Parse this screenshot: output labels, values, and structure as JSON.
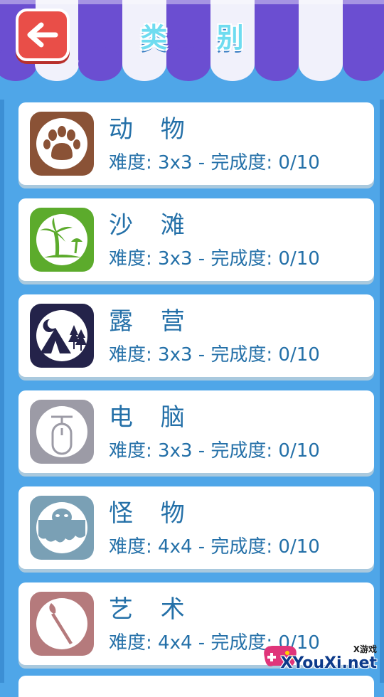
{
  "header": {
    "title": "类 别",
    "back_icon": "arrow-left-icon",
    "colors": {
      "awning_white": "#f1f1fb",
      "awning_purple": "#6b4ed1",
      "back_button": "#e94e48",
      "title": "#6fdcf0"
    }
  },
  "categories": [
    {
      "name": "动 物",
      "info": "难度: 3x3 - 完成度: 0/10",
      "icon": "paw-icon",
      "icon_bg": "#8a5236"
    },
    {
      "name": "沙 滩",
      "info": "难度: 3x3 - 完成度: 0/10",
      "icon": "palm-tree-icon",
      "icon_bg": "#5cab2c"
    },
    {
      "name": "露 营",
      "info": "难度: 3x3 - 完成度: 0/10",
      "icon": "tent-icon",
      "icon_bg": "#24234a"
    },
    {
      "name": "电 脑",
      "info": "难度: 3x3 - 完成度: 0/10",
      "icon": "computer-mouse-icon",
      "icon_bg": "#9c9ba6"
    },
    {
      "name": "怪 物",
      "info": "难度: 4x4 - 完成度: 0/10",
      "icon": "monster-icon",
      "icon_bg": "#7aa0b5"
    },
    {
      "name": "艺 术",
      "info": "难度: 4x4 - 完成度: 0/10",
      "icon": "paintbrush-icon",
      "icon_bg": "#b57a7c"
    }
  ],
  "watermark": {
    "small": "X游戏",
    "text": "XYouXi.net"
  },
  "colors": {
    "background": "#4fa6e8",
    "text": "#2470a8",
    "card": "#ffffff"
  }
}
